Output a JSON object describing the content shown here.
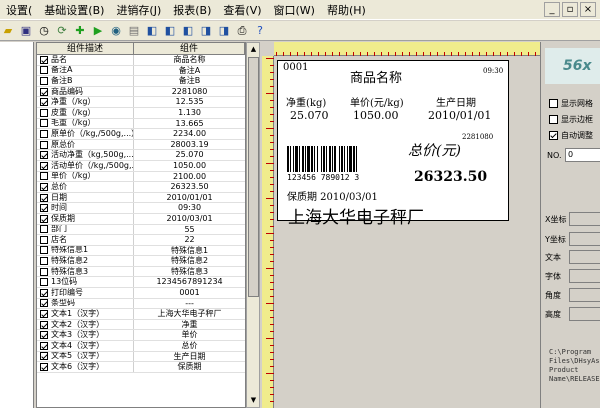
{
  "menu": {
    "items": [
      "设置(",
      "基础设置(B)",
      "进销存(J)",
      "报表(B)",
      "查看(V)",
      "窗口(W)",
      "帮助(H)"
    ]
  },
  "toolbar": {
    "icons": [
      "open-icon",
      "save-icon",
      "clock-icon",
      "refresh-icon",
      "add-icon",
      "play-icon",
      "disk-icon",
      "db-icon",
      "db2-icon",
      "db3-icon",
      "db4-icon",
      "db5-icon",
      "db6-icon",
      "print-icon",
      "help-icon"
    ]
  },
  "grid": {
    "headers": [
      "组件描述",
      "组件"
    ],
    "rows": [
      {
        "checked": true,
        "label": "品名",
        "value": "商品名称"
      },
      {
        "checked": false,
        "label": "备注A",
        "value": "备注A"
      },
      {
        "checked": false,
        "label": "备注B",
        "value": "备注B"
      },
      {
        "checked": true,
        "label": "商品编码",
        "value": "2281080"
      },
      {
        "checked": true,
        "label": "净重（/kg）",
        "value": "12.535"
      },
      {
        "checked": false,
        "label": "皮重（/kg）",
        "value": "1.130"
      },
      {
        "checked": false,
        "label": "毛重（/kg）",
        "value": "13.665"
      },
      {
        "checked": false,
        "label": "原单价（/kg,/500g,...）",
        "value": "2234.00"
      },
      {
        "checked": false,
        "label": "原总价",
        "value": "28003.19"
      },
      {
        "checked": true,
        "label": "活动净重（kg,500g,...）",
        "value": "25.070"
      },
      {
        "checked": true,
        "label": "活动单价（/kg,/500g,...）",
        "value": "1050.00"
      },
      {
        "checked": false,
        "label": "单价（/kg）",
        "value": "2100.00"
      },
      {
        "checked": true,
        "label": "总价",
        "value": "26323.50"
      },
      {
        "checked": true,
        "label": "日期",
        "value": "2010/01/01"
      },
      {
        "checked": true,
        "label": "时间",
        "value": "09:30"
      },
      {
        "checked": true,
        "label": "保质期",
        "value": "2010/03/01"
      },
      {
        "checked": false,
        "label": "部门",
        "value": "55"
      },
      {
        "checked": false,
        "label": "店名",
        "value": "22"
      },
      {
        "checked": false,
        "label": "特殊信息1",
        "value": "特殊信息1"
      },
      {
        "checked": false,
        "label": "特殊信息2",
        "value": "特殊信息2"
      },
      {
        "checked": false,
        "label": "特殊信息3",
        "value": "特殊信息3"
      },
      {
        "checked": false,
        "label": "13位码",
        "value": "1234567891234"
      },
      {
        "checked": true,
        "label": "打印编号",
        "value": "0001"
      },
      {
        "checked": true,
        "label": "条型码",
        "value": "---"
      },
      {
        "checked": true,
        "label": "文本1（汉字）",
        "value": "上海大华电子秤厂"
      },
      {
        "checked": true,
        "label": "文本2（汉字）",
        "value": "净重"
      },
      {
        "checked": true,
        "label": "文本3（汉字）",
        "value": "单价"
      },
      {
        "checked": true,
        "label": "文本4（汉字）",
        "value": "总价"
      },
      {
        "checked": true,
        "label": "文本5（汉字）",
        "value": "生产日期"
      },
      {
        "checked": true,
        "label": "文本6（汉字）",
        "value": "保质期"
      }
    ]
  },
  "label": {
    "serial": "0001",
    "product_name": "商品名称",
    "time": "09:30",
    "weight_title": "净重(kg)",
    "price_title": "单价(元/kg)",
    "date_title": "生产日期",
    "weight": "25.070",
    "price": "1050.00",
    "date": "2010/01/01",
    "code": "2281080",
    "total_title": "总价(元)",
    "barcode_digits": "123456 789012 3",
    "total": "26323.50",
    "shelf_life": "保质期 2010/03/01",
    "company": "上海大华电子秤厂"
  },
  "right_panel": {
    "logo": "56x",
    "show_grid": "显示网格",
    "show_border": "显示边框",
    "auto_adjust": "自动调整",
    "no_label": "NO.",
    "no_value": "0",
    "x_label": "X坐标",
    "y_label": "Y坐标",
    "text_label": "文本",
    "font_label": "字体",
    "angle_label": "角度",
    "height_label": "高度",
    "path": "C:\\Program\nFiles\\DHsyAs\nProduct\nName\\RELEASE"
  }
}
